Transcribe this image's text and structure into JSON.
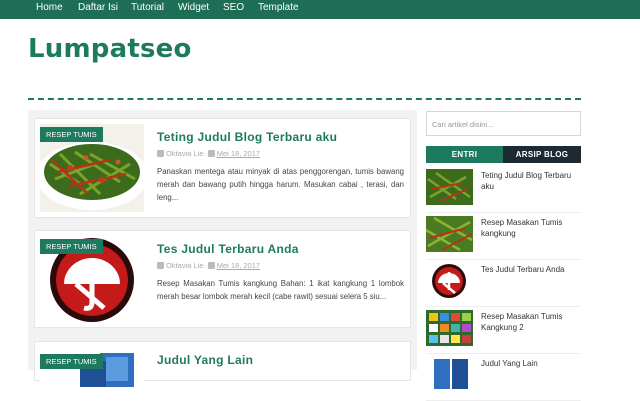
{
  "nav": {
    "items": [
      {
        "label": "Home"
      },
      {
        "label": "Daftar Isi"
      },
      {
        "label": "Tutorial"
      },
      {
        "label": "Widget"
      },
      {
        "label": "SEO"
      },
      {
        "label": "Template"
      }
    ]
  },
  "header": {
    "title": "Lumpatseo"
  },
  "posts": [
    {
      "label": "RESEP TUMIS",
      "title": "Teting Judul Blog Terbaru aku",
      "author": "Oktavia Lie",
      "date": "Mei 18, 2017",
      "snippet": "Panaskan mentega atau minyak di atas penggorengan, tumis bawang merah dan bawang putih hingga harum. Masukan cabai , terasi, dan leng...",
      "image": "stir-fried-kangkung"
    },
    {
      "label": "RESEP TUMIS",
      "title": "Tes Judul Terbaru Anda",
      "author": "Oktavia Lie",
      "date": "Mei 18, 2017",
      "snippet": "Resep Masakan Tumis kangkung Bahan: 1 ikat kangkung 1 lombok merah besar lombok merah kecil (cabe rawit) sesuai selera 5 siu...",
      "image": "red-antivirus-logo"
    },
    {
      "label": "RESEP TUMIS",
      "title": "Judul Yang Lain",
      "image": "blue-boxes"
    }
  ],
  "sidebar": {
    "search_placeholder": "Cari artikel disini...",
    "tabs": [
      {
        "label": "ENTRI"
      },
      {
        "label": "ARSIP BLOG"
      }
    ],
    "items": [
      {
        "title": "Teting Judul Blog Terbaru aku",
        "image": "stir-fried-kangkung"
      },
      {
        "title": "Resep Masakan Tumis kangkung",
        "image": "stir-fried-kangkung"
      },
      {
        "title": "Tes Judul Terbaru Anda",
        "image": "red-antivirus-logo"
      },
      {
        "title": "Resep Masakan Tumis Kangkung 2",
        "image": "app-icons-screen"
      },
      {
        "title": "Judul Yang Lain",
        "image": "blue-boxes"
      }
    ]
  },
  "colors": {
    "brand_green": "#1e7a5f",
    "nav_bg": "#1e6e56",
    "dark_tab": "#1b2a33"
  }
}
